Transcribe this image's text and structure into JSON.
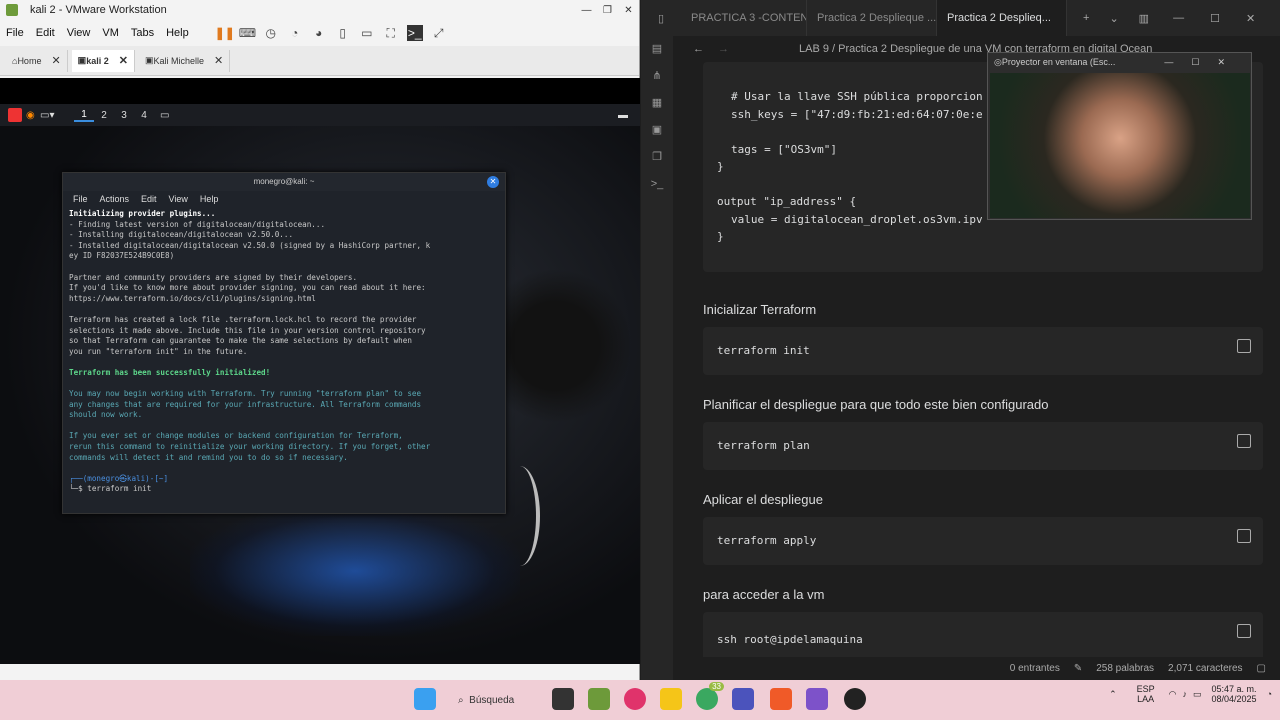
{
  "vmware": {
    "title": "kali 2 - VMware Workstation",
    "menu": [
      "File",
      "Edit",
      "View",
      "VM",
      "Tabs",
      "Help"
    ],
    "tabs": [
      {
        "label": "Home"
      },
      {
        "label": "kali 2"
      },
      {
        "label": "Kali Michelle"
      }
    ]
  },
  "kali": {
    "workspaces": [
      "1",
      "2",
      "3",
      "4"
    ]
  },
  "terminal": {
    "title": "monegro@kali: ~",
    "menu": [
      "File",
      "Actions",
      "Edit",
      "View",
      "Help"
    ],
    "lines": [
      {
        "t": "Initializing provider plugins...",
        "c": "b"
      },
      {
        "t": "- Finding latest version of digitalocean/digitalocean...",
        "c": ""
      },
      {
        "t": "- Installing digitalocean/digitalocean v2.50.0...",
        "c": ""
      },
      {
        "t": "- Installed digitalocean/digitalocean v2.50.0 (signed by a HashiCorp partner, k",
        "c": ""
      },
      {
        "t": "ey ID F82037E524B9C0E8)",
        "c": ""
      },
      {
        "t": "",
        "c": ""
      },
      {
        "t": "Partner and community providers are signed by their developers.",
        "c": ""
      },
      {
        "t": "If you'd like to know more about provider signing, you can read about it here:",
        "c": ""
      },
      {
        "t": "https://www.terraform.io/docs/cli/plugins/signing.html",
        "c": ""
      },
      {
        "t": "",
        "c": ""
      },
      {
        "t": "Terraform has created a lock file .terraform.lock.hcl to record the provider",
        "c": ""
      },
      {
        "t": "selections it made above. Include this file in your version control repository",
        "c": ""
      },
      {
        "t": "so that Terraform can guarantee to make the same selections by default when",
        "c": ""
      },
      {
        "t": "you run \"terraform init\" in the future.",
        "c": ""
      },
      {
        "t": "",
        "c": ""
      },
      {
        "t": "Terraform has been successfully initialized!",
        "c": "g"
      },
      {
        "t": "",
        "c": ""
      },
      {
        "t": "You may now begin working with Terraform. Try running \"terraform plan\" to see",
        "c": "cy"
      },
      {
        "t": "any changes that are required for your infrastructure. All Terraform commands",
        "c": "cy"
      },
      {
        "t": "should now work.",
        "c": "cy"
      },
      {
        "t": "",
        "c": ""
      },
      {
        "t": "If you ever set or change modules or backend configuration for Terraform,",
        "c": "cy"
      },
      {
        "t": "rerun this command to reinitialize your working directory. If you forget, other",
        "c": "cy"
      },
      {
        "t": "commands will detect it and remind you to do so if necessary.",
        "c": "cy"
      },
      {
        "t": "",
        "c": ""
      },
      {
        "t": "┌──(monegro㉿kali)-[~]",
        "c": "pr"
      },
      {
        "t": "└─$ terraform init",
        "c": ""
      }
    ]
  },
  "obsidian": {
    "tabs": [
      "PRACTICA 3 -CONTEN...",
      "Practica 2 Desplieque ...",
      "Practica 2 Desplieq..."
    ],
    "breadcrumb": "LAB 9 / Practica 2 Despliegue de una VM con terraform en digital Ocean",
    "code_top": [
      "# Usar la llave SSH pública proporcion",
      "ssh_keys = [\"47:d9:fb:21:ed:64:07:0e:e",
      "",
      "tags = [\"OS3vm\"]",
      "}",
      "",
      "output \"ip_address\" {",
      "value = digitalocean_droplet.os3vm.ipv",
      "}"
    ],
    "sections": [
      {
        "heading": "Inicializar Terraform",
        "code": "terraform init"
      },
      {
        "heading": "Planificar el despliegue para que todo este bien configurado",
        "code": "terraform plan"
      },
      {
        "heading": "Aplicar el despliegue",
        "code": "terraform apply"
      },
      {
        "heading": "para acceder a la vm",
        "code": "ssh root@ipdelamaquina"
      }
    ],
    "status": {
      "backlinks": "0 entrantes",
      "words": "258 palabras",
      "chars": "2,071 caracteres"
    }
  },
  "camera": {
    "title": "Proyector en ventana (Esc..."
  },
  "taskbar": {
    "search": "Búsqueda",
    "lang": "ESP",
    "layout": "LAA",
    "time": "05:47 a. m.",
    "date": "08/04/2025",
    "badge": "33"
  }
}
